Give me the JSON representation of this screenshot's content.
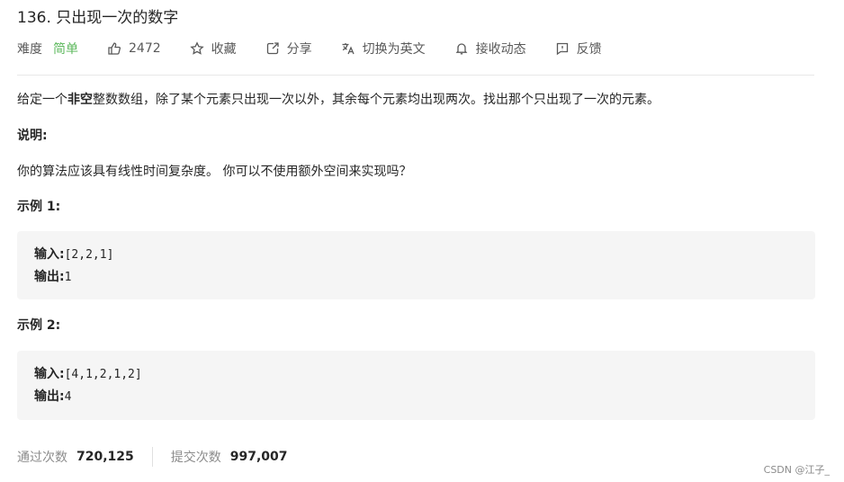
{
  "problem": {
    "title": "136. 只出现一次的数字",
    "difficulty_label": "难度",
    "difficulty": "简单",
    "difficulty_color": "#5cb85c"
  },
  "actions": {
    "likes": "2472",
    "favorite": "收藏",
    "share": "分享",
    "switch_language": "切换为英文",
    "notifications": "接收动态",
    "feedback": "反馈"
  },
  "description": {
    "p1_before": "给定一个",
    "p1_bold": "非空",
    "p1_after": "整数数组，除了某个元素只出现一次以外，其余每个元素均出现两次。找出那个只出现了一次的元素。",
    "note_title": "说明:",
    "p2": "你的算法应该具有线性时间复杂度。 你可以不使用额外空间来实现吗？"
  },
  "examples": [
    {
      "title": "示例 1:",
      "input_label": "输入:",
      "input_value": "[2,2,1]",
      "output_label": "输出:",
      "output_value": "1"
    },
    {
      "title": "示例 2:",
      "input_label": "输入:",
      "input_value": "[4,1,2,1,2]",
      "output_label": "输出:",
      "output_value": "4"
    }
  ],
  "stats": {
    "accepted_label": "通过次数",
    "accepted_value": "720,125",
    "submissions_label": "提交次数",
    "submissions_value": "997,007"
  },
  "watermark": "CSDN @江子_"
}
